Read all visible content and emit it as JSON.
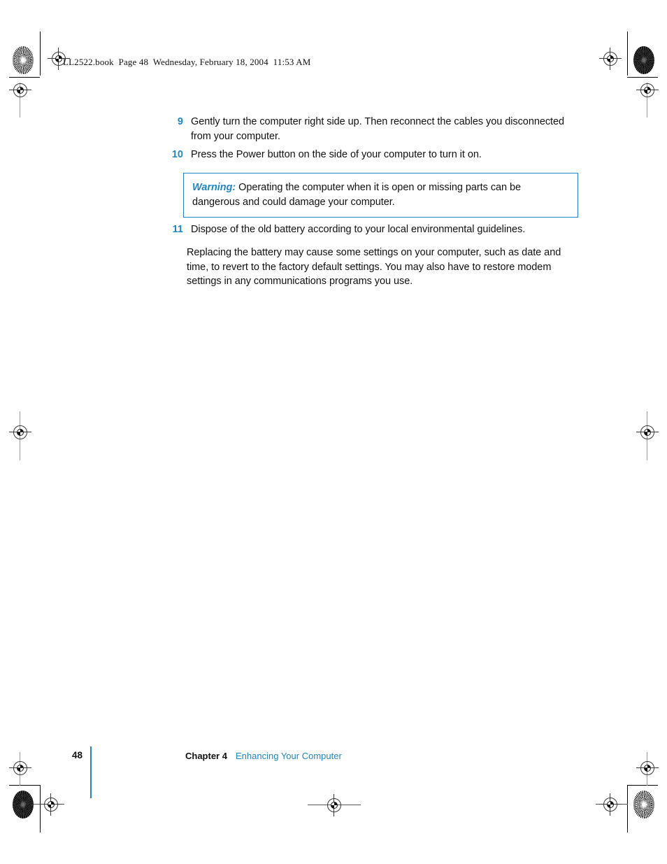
{
  "page": {
    "header_slug": "LL2522.book  Page 48  Wednesday, February 18, 2004  11:53 AM",
    "accent_color": "#2186c4",
    "text_color": "#111111"
  },
  "steps": [
    {
      "number": "9",
      "text": "Gently turn the computer right side up. Then reconnect the cables you disconnected from your computer."
    },
    {
      "number": "10",
      "text": "Press the Power button on the side of your computer to turn it on."
    },
    {
      "number": "11",
      "text": "Dispose of the old battery according to your local environmental guidelines."
    }
  ],
  "warning": {
    "label": "Warning:",
    "text": " Operating the computer when it is open or missing parts can be dangerous and could damage your computer."
  },
  "paragraph": {
    "text": "Replacing the battery may cause some settings on your computer, such as date and time, to revert to the factory default settings. You may also have to restore modem settings in any communications programs you use."
  },
  "footer": {
    "page_number": "48",
    "chapter": "Chapter 4",
    "chapter_title": "Enhancing Your Computer"
  },
  "marks": {
    "registration_target": "registration-target",
    "starburst": "color-registration-starburst",
    "trim_rule": "trim-rule"
  }
}
